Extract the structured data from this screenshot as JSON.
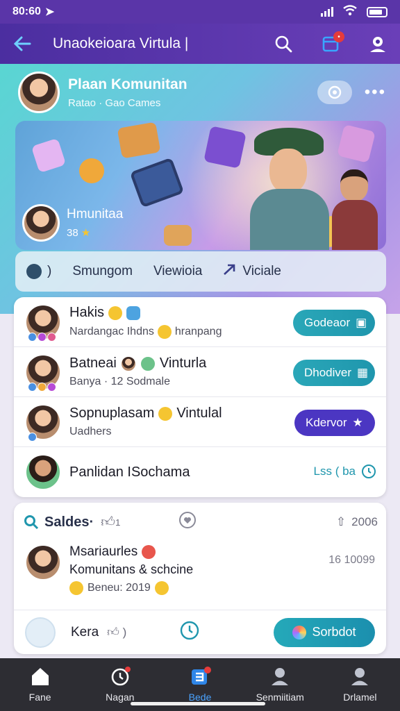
{
  "status": {
    "time": "80:60"
  },
  "header": {
    "title": "Unaokeioara Virtula |"
  },
  "profile": {
    "name": "Plaan Komunitan",
    "subtitle": "Ratao · Gao Cames"
  },
  "banner": {
    "community_name": "Hmunitaa",
    "rating": "38"
  },
  "actions": {
    "left": "Smungom",
    "middle": "Viewioia",
    "right": "Viciale"
  },
  "list": [
    {
      "title": "Hakis",
      "subtitle": "Nardangac Ihdns",
      "subtitle_extra": "hranpang",
      "button": "Godeaor"
    },
    {
      "title": "Batneai",
      "title_extra": "Vinturla",
      "subtitle": "Banya · 12 Sodmale",
      "button": "Dhodiver"
    },
    {
      "title": "Sopnuplasam",
      "title_extra": "Vintulal",
      "subtitle": "Uadhers",
      "button": "Kdervor"
    },
    {
      "title": "Panlidan ISochama",
      "link": "Lss ( ba"
    }
  ],
  "feed": {
    "title": "Saldes·",
    "likes": "1",
    "count": "2006",
    "post": {
      "title": "Msariaurles",
      "line2": "Komunitans & schcine",
      "meta": "Beneu: 2019",
      "time": "16 10099"
    },
    "footer": {
      "name": "Kera",
      "cta": "Sorbdot"
    }
  },
  "tabs": [
    {
      "label": "Fane",
      "icon": "home-icon"
    },
    {
      "label": "Nagan",
      "icon": "alarm-icon"
    },
    {
      "label": "Bede",
      "icon": "game-icon"
    },
    {
      "label": "Senmiitiam",
      "icon": "person-icon"
    },
    {
      "label": "Drlamel",
      "icon": "profile-icon"
    }
  ],
  "colors": {
    "accent": "#4b2ea0",
    "teal": "#1f96ad",
    "purple_button": "#4b36c2",
    "tabbar": "#2d2d33"
  }
}
